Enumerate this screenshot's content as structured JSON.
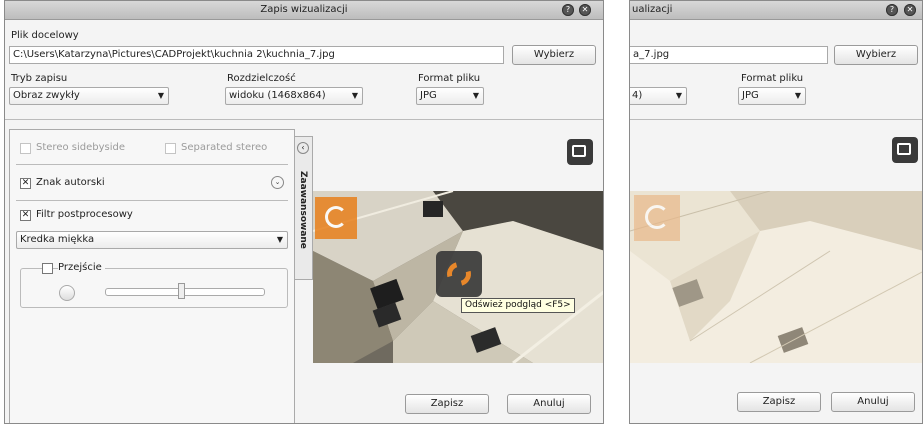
{
  "dialog": {
    "title": "Zapis wizualizacji",
    "file_label": "Plik docelowy",
    "file_path": "C:\\Users\\Katarzyna\\Pictures\\CADProjekt\\kuchnia 2\\kuchnia_7.jpg",
    "choose_button": "Wybierz",
    "save_mode_label": "Tryb zapisu",
    "save_mode_value": "Obraz zwykły",
    "resolution_label": "Rozdzielczość",
    "resolution_value": "widoku (1468x864)",
    "format_label": "Format pliku",
    "format_value": "JPG",
    "save_button": "Zapisz",
    "cancel_button": "Anuluj"
  },
  "advanced": {
    "tab_label": "Zaawansowane",
    "stereo_sbs": "Stereo sidebyside",
    "separated_stereo": "Separated stereo",
    "signature": "Znak autorski",
    "postprocess": "Filtr postprocesowy",
    "filter_value": "Kredka miękka",
    "transition": "Przejście"
  },
  "preview": {
    "tooltip": "Odśwież podgląd <F5>"
  },
  "second_dialog": {
    "title_fragment": "ualizacji",
    "file_fragment": "a_7.jpg",
    "choose_button": "Wybierz",
    "format_label": "Format pliku",
    "resolution_fragment": "4)",
    "format_value": "JPG",
    "save_button": "Zapisz",
    "cancel_button": "Anuluj"
  },
  "colors": {
    "accent_orange": "#e8801c",
    "titlebar": "#c8c8c8",
    "refresh_bg": "#3a3a3a"
  }
}
